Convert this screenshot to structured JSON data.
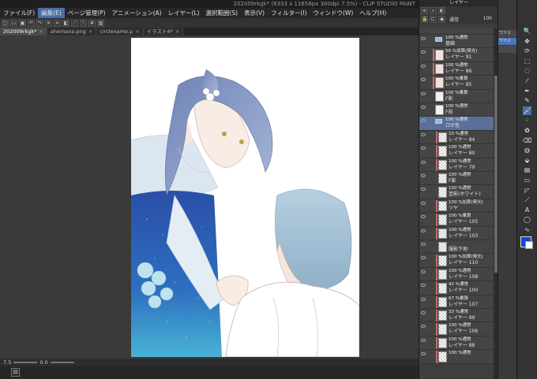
{
  "app": {
    "title": "202009rkgk* (8333 x 11658px 300dpi 7.5%) - CLIP STUDIO PAINT"
  },
  "menu": [
    "ファイル(F)",
    "編集(E)",
    "ページ管理(P)",
    "アニメーション(A)",
    "レイヤー(L)",
    "選択範囲(S)",
    "表示(V)",
    "フィルター(I)",
    "ウィンドウ(W)",
    "ヘルプ(H)"
  ],
  "menu_selected": "編集(E)",
  "tabs": [
    {
      "label": "202009rkgk*",
      "active": true
    },
    {
      "label": "ahemana.png",
      "active": false
    },
    {
      "label": "circlename.p",
      "active": false
    },
    {
      "label": "イラスト4*",
      "active": false
    }
  ],
  "bottom": {
    "zoom": "7.5",
    "rotate": "0.0"
  },
  "layer_panel": {
    "title": "レイヤー",
    "blend": "通常",
    "opacity": "100",
    "layers": [
      {
        "l1": "",
        "l2": "",
        "type": "partial"
      },
      {
        "l1": "100 %通常",
        "l2": "基線",
        "type": "folder"
      },
      {
        "l1": "56 %加算(発光)",
        "l2": "レイヤー 91",
        "type": "pink",
        "clip": true
      },
      {
        "l1": "100 %通常",
        "l2": "レイヤー 86",
        "type": "pink",
        "clip": true
      },
      {
        "l1": "100 %乗算",
        "l2": "レイヤー 85",
        "type": "pink",
        "clip": true
      },
      {
        "l1": "100 %乗算",
        "l2": "F影",
        "type": "white"
      },
      {
        "l1": "100 %通常",
        "l2": "F前",
        "type": "white"
      },
      {
        "l1": "100 %通常",
        "l2": "ロゼ色",
        "type": "folder",
        "selected": true
      },
      {
        "l1": "10 %通常",
        "l2": "レイヤー 84",
        "type": "checker",
        "clip": true,
        "indent": true
      },
      {
        "l1": "100 %通常",
        "l2": "レイヤー 80",
        "type": "checker",
        "clip": true,
        "indent": true
      },
      {
        "l1": "100 %通常",
        "l2": "レイヤー 79",
        "type": "checker",
        "clip": true,
        "indent": true
      },
      {
        "l1": "100 %通常",
        "l2": "F影",
        "type": "checker",
        "indent": true
      },
      {
        "l1": "100 %通常",
        "l2": "塗影(ホワイト)",
        "type": "checker",
        "indent": true
      },
      {
        "l1": "100 %加算(発光)",
        "l2": "ツヤ",
        "type": "checker",
        "clip": true,
        "indent": true
      },
      {
        "l1": "100 %乗算",
        "l2": "レイヤー 105",
        "type": "checker",
        "clip": true,
        "indent": true
      },
      {
        "l1": "100 %通常",
        "l2": "レイヤー 103",
        "type": "checker",
        "clip": true,
        "indent": true
      },
      {
        "l1": "",
        "l2": "服影下地",
        "type": "checker",
        "indent": true
      },
      {
        "l1": "100 %加算(発光)",
        "l2": "レイヤー 110",
        "type": "checker",
        "clip": true,
        "indent": true
      },
      {
        "l1": "100 %通常",
        "l2": "レイヤー 108",
        "type": "checker",
        "clip": true,
        "indent": true
      },
      {
        "l1": "42 %通常",
        "l2": "レイヤー 100",
        "type": "checker",
        "clip": true,
        "indent": true
      },
      {
        "l1": "67 %乗算",
        "l2": "レイヤー 107",
        "type": "checker",
        "clip": true,
        "indent": true
      },
      {
        "l1": "33 %通常",
        "l2": "レイヤー 99",
        "type": "checker",
        "clip": true,
        "indent": true
      },
      {
        "l1": "100 %通常",
        "l2": "レイヤー 106",
        "type": "checker",
        "clip": true,
        "indent": true
      },
      {
        "l1": "100 %通常",
        "l2": "レイヤー 88",
        "type": "checker",
        "clip": true,
        "indent": true
      },
      {
        "l1": "100 %通常",
        "l2": "",
        "type": "checker",
        "clip": true,
        "indent": true
      }
    ]
  },
  "subtools": [
    {
      "label": "ワト1",
      "selected": false
    },
    {
      "label": "ワト2",
      "selected": true
    },
    {
      "label": "",
      "selected": false
    }
  ],
  "tools": [
    "magnifier-icon",
    "move-icon",
    "rotate-icon",
    "select-icon",
    "lasso-icon",
    "eyedropper-icon",
    "pen-icon",
    "pencil-icon",
    "brush-icon",
    "airbrush-icon",
    "decorate-icon",
    "eraser-icon",
    "blend-icon",
    "fill-icon",
    "gradient-icon",
    "shape-icon",
    "frame-icon",
    "ruler-icon",
    "text-icon",
    "balloon-icon",
    "line-correct-icon"
  ],
  "tool_glyphs": [
    "🔍",
    "✥",
    "⟳",
    "⬚",
    "◌",
    "⁄",
    "✒",
    "✎",
    "🖌",
    "⁘",
    "✿",
    "⌫",
    "◍",
    "⬙",
    "▤",
    "▭",
    "◸",
    "⟋",
    "A",
    "◯",
    "∿"
  ],
  "tool_selected": "brush-icon",
  "colors": {
    "foreground": "#1a3fd6",
    "background": "#ffffff",
    "accent": "#4a6ea8",
    "selected_layer": "#5b6f9a"
  }
}
